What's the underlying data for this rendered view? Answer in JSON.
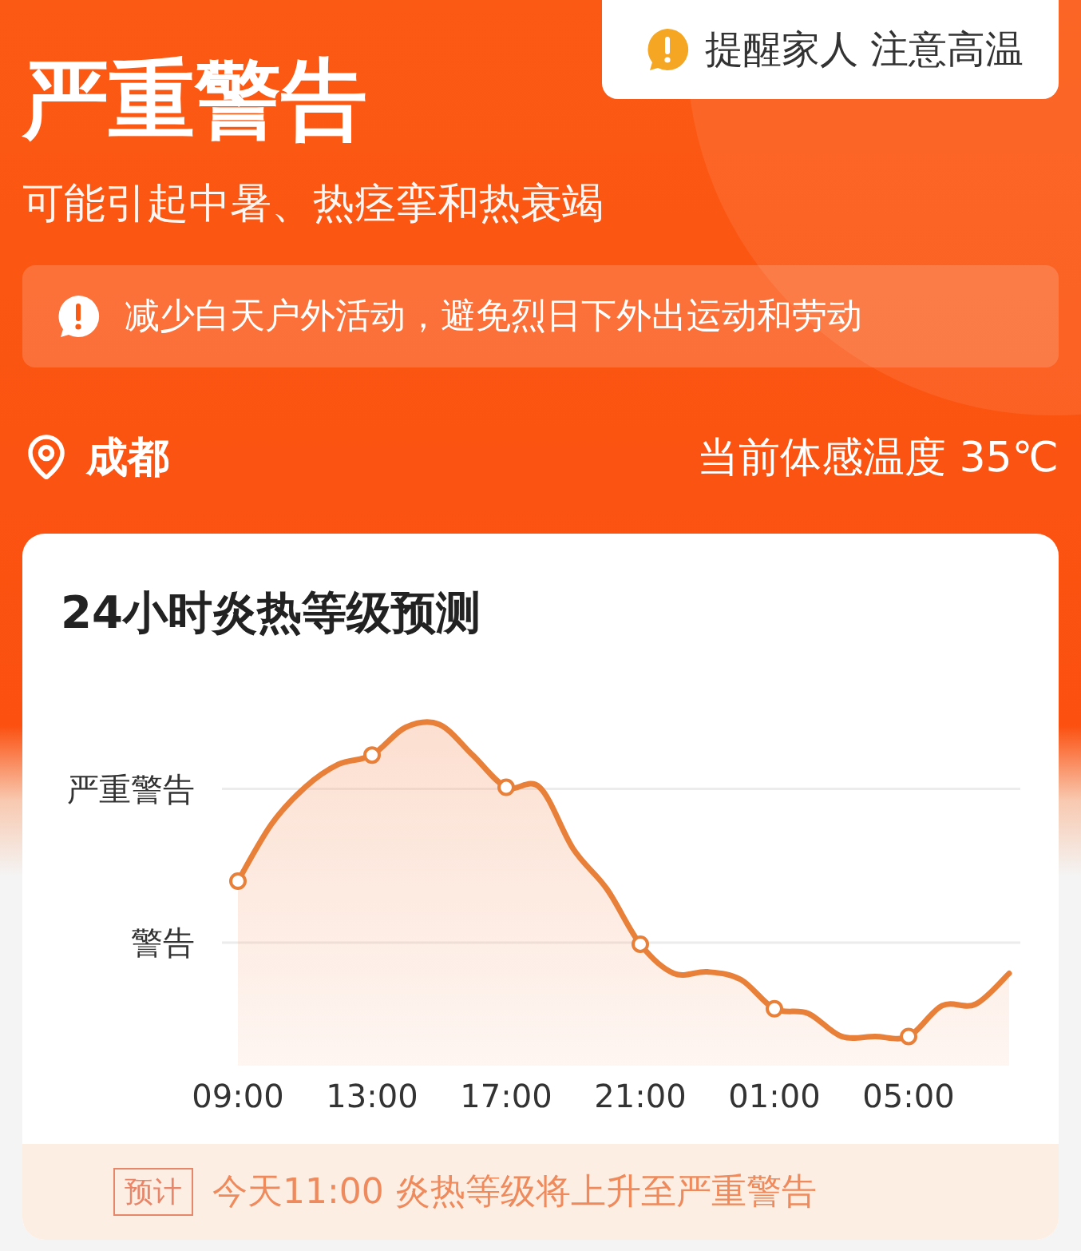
{
  "alert_button": {
    "label": "提醒家人 注意高温"
  },
  "level": {
    "title": "严重警告",
    "subtitle": "可能引起中暑、热痉挛和热衰竭"
  },
  "advice": "减少白天户外活动，避免烈日下外出运动和劳动",
  "location": "成都",
  "feels_like": "当前体感温度 35℃",
  "forecast": {
    "title": "24小时炎热等级预测",
    "chart": {
      "y_labels": [
        "严重警告",
        "警告"
      ],
      "x_labels": [
        "09:00",
        "13:00",
        "17:00",
        "21:00",
        "01:00",
        "05:00"
      ]
    },
    "note": {
      "tag": "预计",
      "text": "今天11:00 炎热等级将上升至严重警告"
    }
  }
}
